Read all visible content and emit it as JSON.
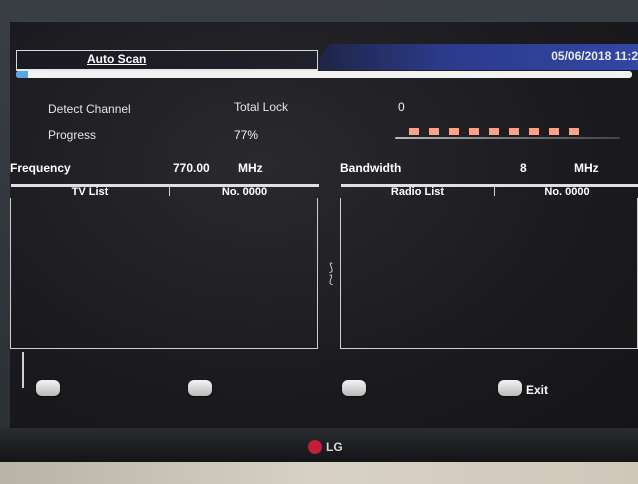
{
  "header": {
    "title": "Auto Scan",
    "datetime": "05/06/2018 11:2",
    "progress": 0.77
  },
  "info": {
    "detect_channel_label": "Detect Channel",
    "total_lock_label": "Total Lock",
    "total_lock_value": "0",
    "progress_label": "Progress",
    "progress_value": "77%",
    "signal_segments": 9
  },
  "frequency": {
    "label": "Frequency",
    "value": "770.00",
    "unit": "MHz"
  },
  "bandwidth": {
    "label": "Bandwidth",
    "value": "8",
    "unit": "MHz"
  },
  "tv_list": {
    "title": "TV List",
    "count": "No. 0000",
    "items": []
  },
  "radio_list": {
    "title": "Radio List",
    "count": "No. 0000",
    "items": []
  },
  "buttons": {
    "exit_label": "Exit"
  },
  "brand": {
    "logo_text": "LG"
  }
}
